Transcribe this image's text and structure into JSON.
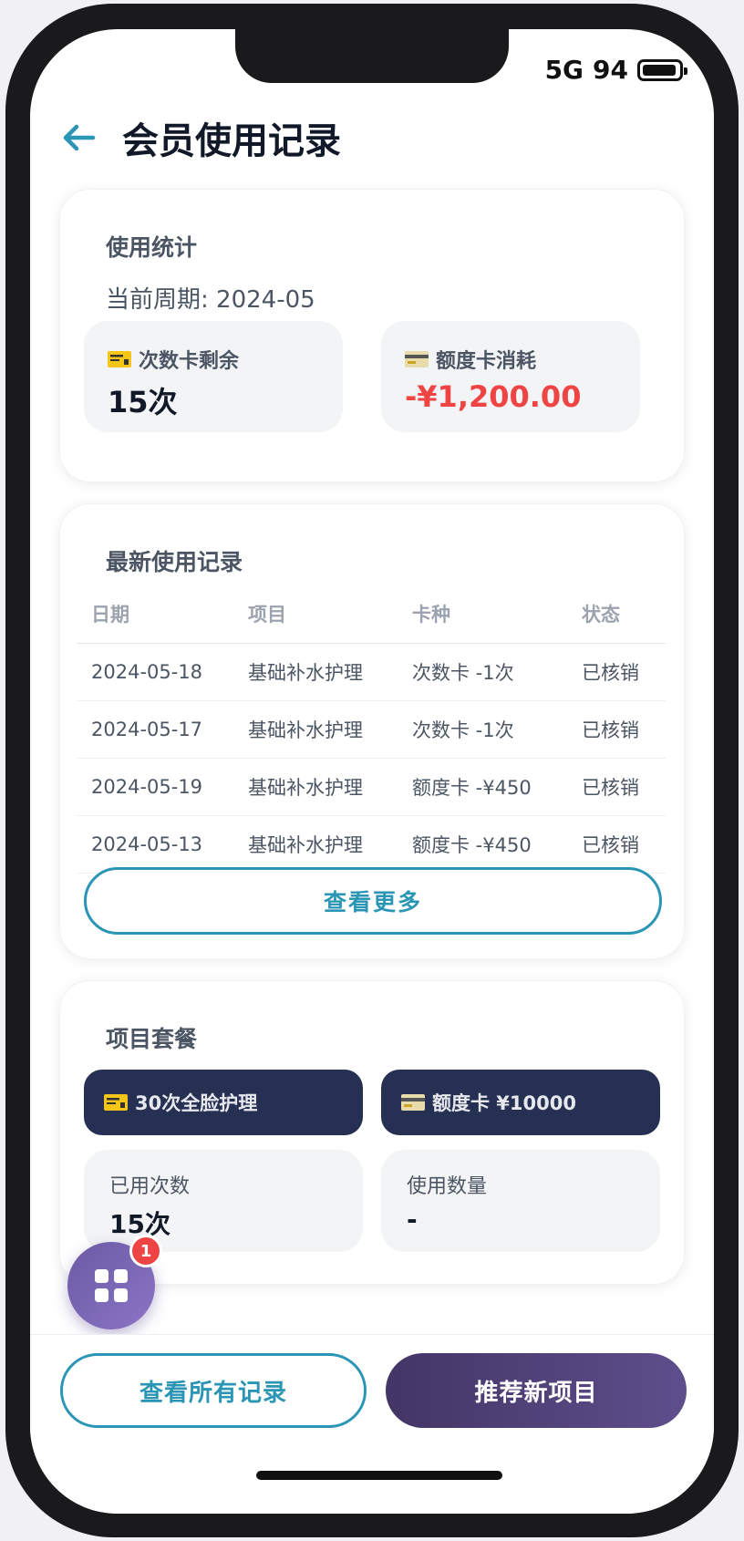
{
  "status_bar": {
    "network": "5G",
    "battery": "94",
    "battery_level": 0.94
  },
  "header": {
    "title": "会员使用记录"
  },
  "stats": {
    "title": "使用统计",
    "period": "当前周期: 2024-05",
    "count_card": {
      "label": "次数卡剩余",
      "value": "15次"
    },
    "amount_card": {
      "label": "额度卡消耗",
      "value": "-¥1,200.00",
      "value_color": "#ef4444"
    }
  },
  "records": {
    "title": "最新使用记录",
    "columns": [
      "日期",
      "项目",
      "卡种",
      "状态"
    ],
    "rows": [
      [
        "2024-05-18",
        "基础补水护理",
        "次数卡 -1次",
        "已核销"
      ],
      [
        "2024-05-17",
        "基础补水护理",
        "次数卡 -1次",
        "已核销"
      ],
      [
        "2024-05-19",
        "基础补水护理",
        "额度卡 -¥450",
        "已核销"
      ],
      [
        "2024-05-13",
        "基础补水护理",
        "额度卡 -¥450",
        "已核销"
      ]
    ],
    "more_label": "查看更多"
  },
  "packages": {
    "title": "项目套餐",
    "items": [
      {
        "label": "30次全脸护理",
        "icon": "ticket-card-icon"
      },
      {
        "label": "额度卡 ¥10000",
        "icon": "credit-card-icon"
      }
    ],
    "usage": [
      {
        "label": "已用次数",
        "value": "15次"
      },
      {
        "label": "使用数量",
        "value": "-"
      }
    ]
  },
  "fab": {
    "icon": "grid-icon",
    "badge": "1"
  },
  "actions": {
    "view_all": "查看所有记录",
    "recommend": "推荐新项目"
  },
  "colors": {
    "accent": "#2a95b5",
    "negative": "#ef4444",
    "package_bg": "#263052",
    "primary_button": "#4b3d72",
    "fab": "#7a67b5"
  }
}
